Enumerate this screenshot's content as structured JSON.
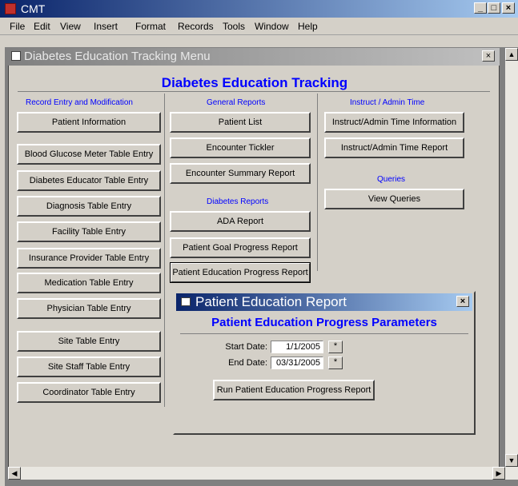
{
  "app": {
    "title": "CMT",
    "min": "_",
    "max": "□",
    "close": "×"
  },
  "menu": [
    "File",
    "Edit",
    "View",
    "Insert",
    "Format",
    "Records",
    "Tools",
    "Window",
    "Help"
  ],
  "inner_window": {
    "title": "Diabetes Education Tracking Menu",
    "close": "×"
  },
  "main_title": "Diabetes Education Tracking",
  "col1": {
    "header": "Record Entry and Modification",
    "buttons": [
      "Patient Information",
      "Blood Glucose Meter Table Entry",
      "Diabetes Educator Table Entry",
      "Diagnosis Table Entry",
      "Facility Table Entry",
      "Insurance Provider Table Entry",
      "Medication Table Entry",
      "Physician Table Entry",
      "Site Table Entry",
      "Site Staff Table Entry",
      "Coordinator Table Entry"
    ]
  },
  "col2": {
    "header": "General Reports",
    "buttons": [
      "Patient List",
      "Encounter Tickler",
      "Encounter Summary Report"
    ],
    "header2": "Diabetes Reports",
    "buttons2": [
      "ADA Report",
      "Patient Goal Progress Report",
      "Patient Education Progress Report"
    ]
  },
  "col3": {
    "header": "Instruct / Admin Time",
    "buttons": [
      "Instruct/Admin Time Information",
      "Instruct/Admin Time Report"
    ],
    "header2": "Queries",
    "buttons2": [
      "View Queries"
    ]
  },
  "dialog": {
    "title": "Patient Education Report",
    "close": "×",
    "heading": "Patient Education Progress Parameters",
    "start_label": "Start Date:",
    "start_value": "1/1/2005",
    "end_label": "End Date:",
    "end_value": "03/31/2005",
    "cal": "*",
    "run_button": "Run Patient Education Progress Report"
  }
}
